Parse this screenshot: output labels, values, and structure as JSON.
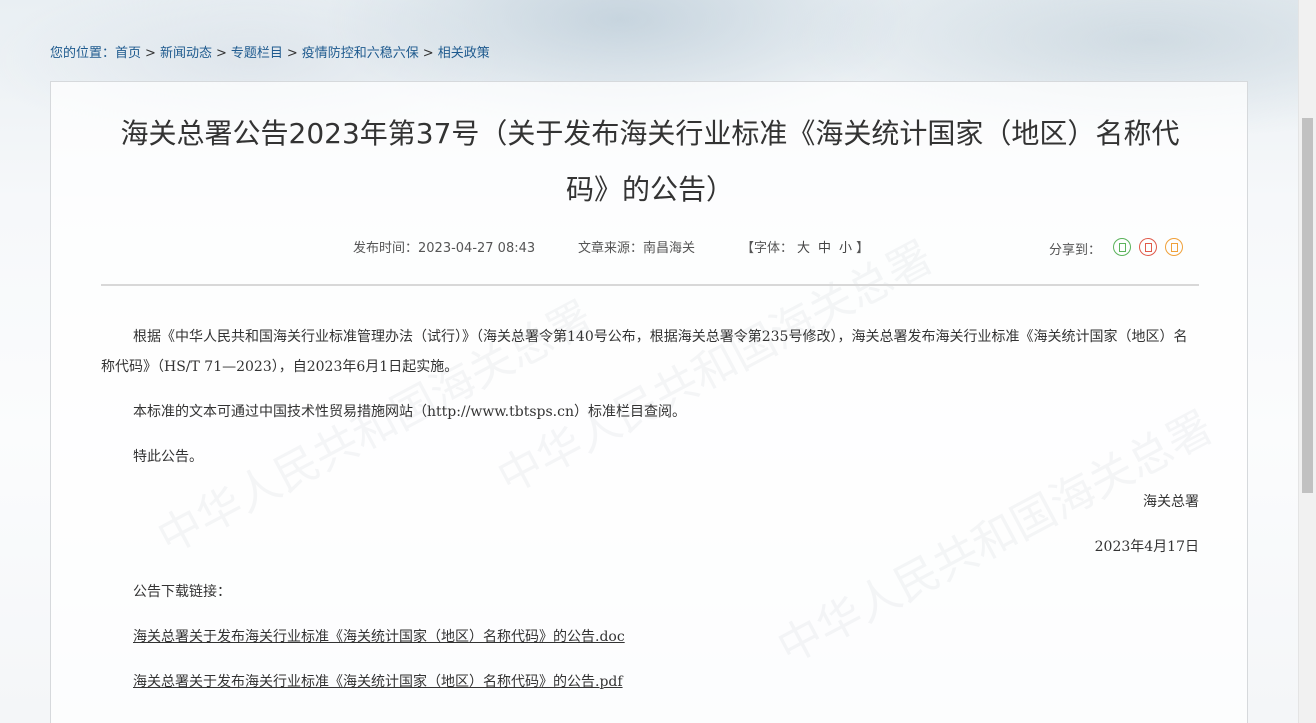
{
  "breadcrumb": {
    "prefix": "您的位置：",
    "items": [
      "首页",
      "新闻动态",
      "专题栏目",
      "疫情防控和六稳六保",
      "相关政策"
    ],
    "separator": ">"
  },
  "article": {
    "title": "海关总署公告2023年第37号（关于发布海关行业标准《海关统计国家（地区）名称代码》的公告）",
    "publish_time": "发布时间：2023-04-27 08:43",
    "source": "文章来源：南昌海关",
    "font_label": "【字体：",
    "font_sizes": [
      "大",
      "中",
      "小"
    ],
    "font_close": "】",
    "share_label": "分享到：",
    "share_icons": [
      "wechat-share-icon",
      "weibo-share-icon",
      "qzone-share-icon"
    ],
    "paragraphs": [
      "根据《中华人民共和国海关行业标准管理办法（试行）》（海关总署令第140号公布，根据海关总署令第235号修改），海关总署发布海关行业标准《海关统计国家（地区）名称代码》（HS/T 71—2023），自2023年6月1日起实施。",
      "本标准的文本可通过中国技术性贸易措施网站（http://www.tbtsps.cn）标准栏目查阅。",
      "特此公告。"
    ],
    "signature": "海关总署",
    "date": "2023年4月17日",
    "download_label": "公告下载链接：",
    "downloads": [
      "海关总署关于发布海关行业标准《海关统计国家（地区）名称代码》的公告.doc",
      "海关总署关于发布海关行业标准《海关统计国家（地区）名称代码》的公告.pdf"
    ]
  },
  "colors": {
    "link": "#1e5a8e",
    "share_green": "#5bb35b",
    "share_red": "#e05a4a",
    "share_orange": "#f0a13a"
  }
}
